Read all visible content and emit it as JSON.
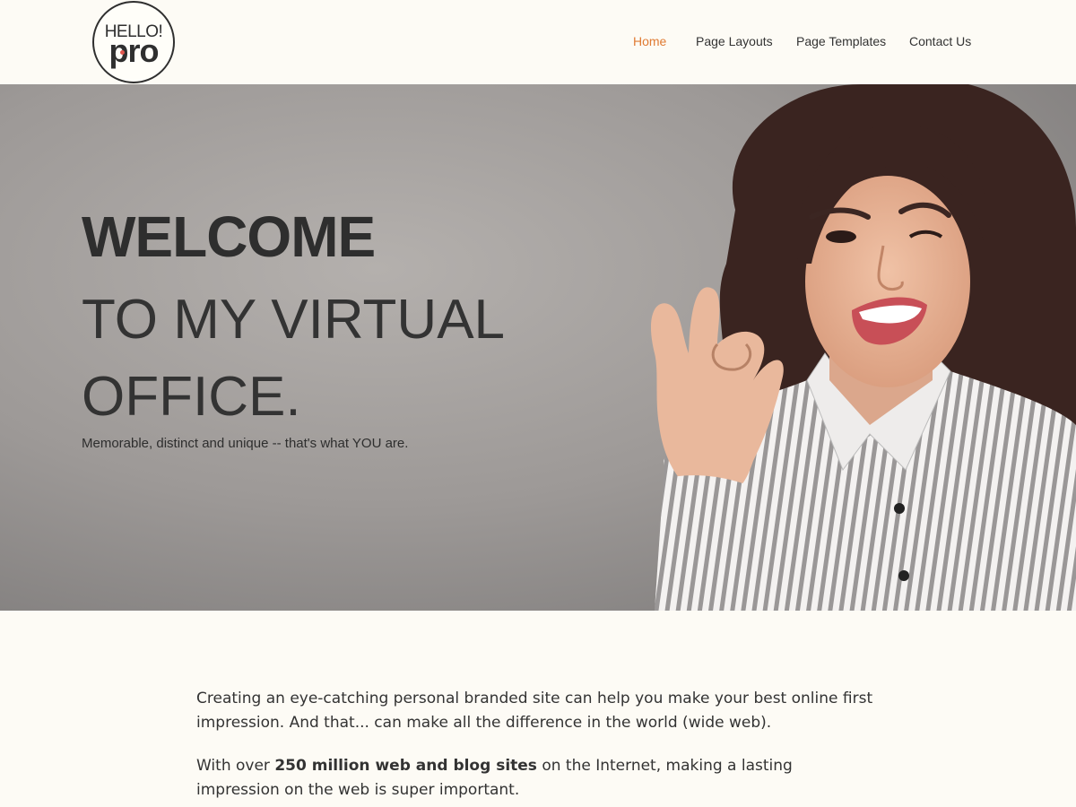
{
  "brand": {
    "logo_top": "HELLO!",
    "logo_bottom": "pro"
  },
  "nav": {
    "items": [
      {
        "label": "Home",
        "active": true
      },
      {
        "label": "Page Layouts",
        "active": false
      },
      {
        "label": "Page Templates",
        "active": false
      },
      {
        "label": "Contact Us",
        "active": false
      }
    ]
  },
  "hero": {
    "title_bold": "WELCOME",
    "title_light": "TO MY VIRTUAL OFFICE.",
    "subtitle": "Memorable, distinct and unique -- that's what YOU are."
  },
  "content": {
    "paragraph1": "Creating an eye-catching personal branded site can help you make your best online first impression. And that... can make all the difference in the world (wide web).",
    "paragraph2_pre": "With over ",
    "paragraph2_bold": "250 million web and blog sites",
    "paragraph2_post": " on the Internet, making a lasting impression on the web is super important."
  },
  "colors": {
    "accent": "#e07b33",
    "background": "#fdfbf5",
    "text": "#333333"
  }
}
